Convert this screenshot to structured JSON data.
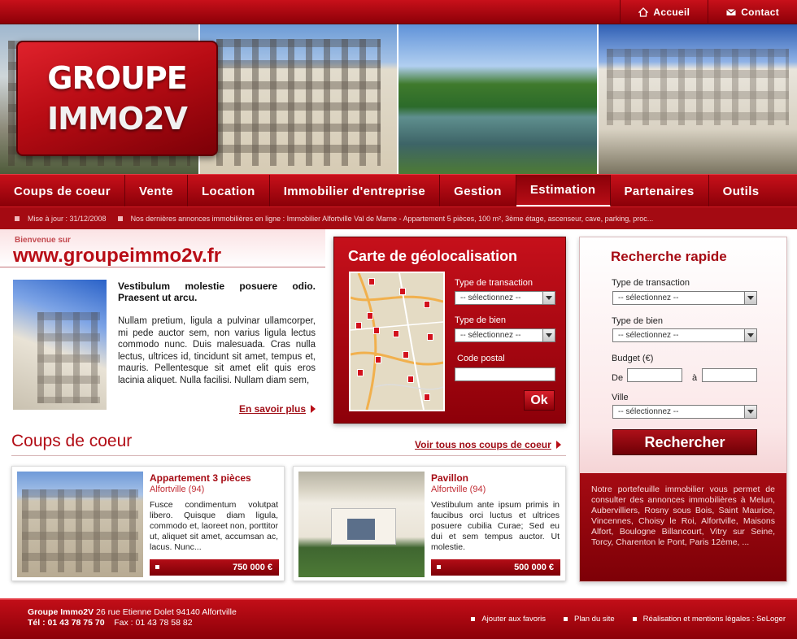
{
  "topnav": {
    "home_label": "Accueil",
    "contact_label": "Contact"
  },
  "logo": {
    "line1": "Groupe",
    "line2": "Immo2v"
  },
  "mainnav": [
    "Coups de coeur",
    "Vente",
    "Location",
    "Immobilier d'entreprise",
    "Gestion",
    "Estimation",
    "Partenaires",
    "Outils"
  ],
  "mainnav_active": "Estimation",
  "ticker": {
    "update": "Mise à jour : 31/12/2008",
    "news": "Nos dernières annonces immobilières en ligne : Immobilier Alfortville Val de Marne - Appartement 5 pièces, 100 m², 3ème étage, ascenseur, cave, parking, proc..."
  },
  "welcome": {
    "small": "Bienvenue sur",
    "site": "www.groupeimmo2v.fr",
    "title": "Vestibulum molestie posuere odio. Praesent ut arcu.",
    "body": "Nullam pretium, ligula a pulvinar ullamcorper, mi pede auctor sem, non varius ligula lectus commodo nunc. Duis malesuada. Cras nulla lectus, ultrices id, tincidunt sit amet, tempus et, mauris. Pellentesque sit amet elit quis eros lacinia aliquet. Nulla facilisi. Nullam diam sem,",
    "more": "En savoir plus"
  },
  "geo": {
    "title": "Carte de géolocalisation",
    "transaction_label": "Type de transaction",
    "transaction_value": "-- sélectionnez --",
    "bien_label": "Type de bien",
    "bien_value": "-- sélectionnez --",
    "cp_label": "Code postal",
    "cp_value": "",
    "ok": "Ok"
  },
  "search": {
    "title": "Recherche rapide",
    "transaction_label": "Type de transaction",
    "transaction_value": "-- sélectionnez --",
    "bien_label": "Type de bien",
    "bien_value": "-- sélectionnez --",
    "budget_label": "Budget (€)",
    "de": "De",
    "a": "à",
    "budget_min": "",
    "budget_max": "",
    "ville_label": "Ville",
    "ville_value": "-- sélectionnez --",
    "button": "Rechercher",
    "portfolio": "Notre portefeuille immobilier vous permet de consulter des annonces immobilières à Melun, Aubervilliers, Rosny sous Bois, Saint Maurice, Vincennes, Choisy le Roi, Alfortville, Maisons Alfort, Boulogne Billancourt, Vitry sur Seine, Torcy, Charenton le Pont, Paris 12ème, ..."
  },
  "cdc": {
    "title": "Coups de coeur",
    "link": "Voir tous nos coups de coeur",
    "cards": [
      {
        "title": "Appartement 3 pièces",
        "city": "Alfortville (94)",
        "desc": "Fusce condimentum volutpat libero. Quisque diam ligula, commodo et, laoreet non, porttitor ut, aliquet sit amet, accumsan ac, lacus. Nunc...",
        "price": "750 000 €"
      },
      {
        "title": "Pavillon",
        "city": "Alfortville (94)",
        "desc": "Vestibulum ante ipsum primis in faucibus orci luctus et ultrices posuere cubilia Curae; Sed eu dui et sem tempus auctor. Ut molestie.",
        "price": "500 000 €"
      }
    ]
  },
  "footer": {
    "company": "Groupe Immo2V",
    "address": " 26 rue Etienne Dolet 94140 Alfortville",
    "tel": "Tél : 01 43 78 75 70",
    "fax": "Fax : 01 43 78 58 82",
    "links": [
      "Ajouter aux favoris",
      "Plan du site",
      "Réalisation et mentions légales : SeLoger"
    ]
  },
  "colors": {
    "brand_red": "#b80d16",
    "dark_red": "#8c0008"
  },
  "icons": {
    "home": "home-icon",
    "contact": "mail-icon"
  }
}
